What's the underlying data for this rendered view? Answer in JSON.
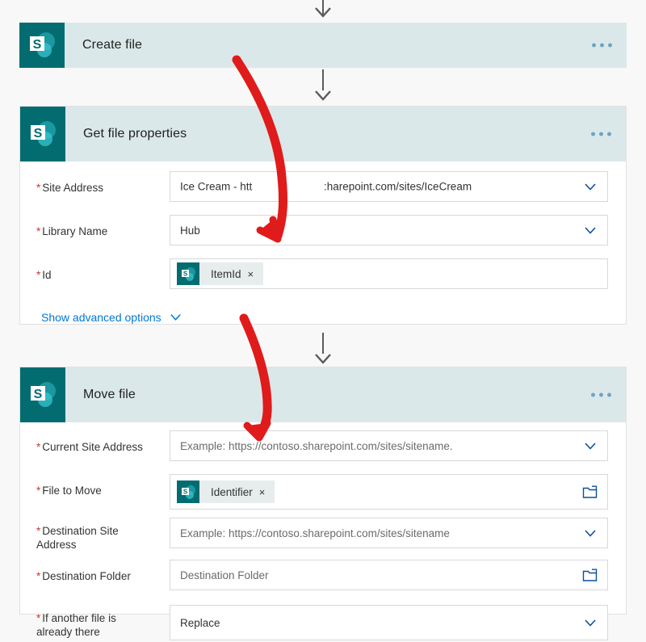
{
  "colors": {
    "sharepoint_teal": "#036C70",
    "card_header_bg": "#DBE8E9",
    "page_bg": "#F8F8F8",
    "annotation_red": "#E01B1B",
    "link_blue": "#0078D4",
    "required_red": "#D13438"
  },
  "cards": [
    {
      "id": "create-file",
      "title": "Create file",
      "icon": "sharepoint-icon",
      "overflow_label": "more-options",
      "fields": []
    },
    {
      "id": "get-file-properties",
      "title": "Get file properties",
      "icon": "sharepoint-icon",
      "overflow_label": "more-options",
      "fields": [
        {
          "label": "Site Address",
          "required": true,
          "type": "dropdown-split",
          "value_left": "Ice Cream - htt",
          "value_right": ":harepoint.com/sites/IceCream"
        },
        {
          "label": "Library Name",
          "required": true,
          "type": "dropdown",
          "value": "Hub"
        },
        {
          "label": "Id",
          "required": true,
          "type": "token",
          "token_label": "ItemId",
          "token_remove": "×",
          "token_icon": "sharepoint-icon"
        }
      ],
      "advanced_options_label": "Show advanced options"
    },
    {
      "id": "move-file",
      "title": "Move file",
      "icon": "sharepoint-icon",
      "overflow_label": "more-options",
      "fields": [
        {
          "label": "Current Site Address",
          "required": true,
          "type": "dropdown",
          "placeholder": "Example: https://contoso.sharepoint.com/sites/sitename."
        },
        {
          "label": "File to Move",
          "required": true,
          "type": "token-folder",
          "token_label": "Identifier",
          "token_remove": "×",
          "token_icon": "sharepoint-icon"
        },
        {
          "label": "Destination Site Address",
          "label_line1": "Destination Site",
          "label_line2": "Address",
          "required": true,
          "type": "dropdown",
          "placeholder": "Example: https://contoso.sharepoint.com/sites/sitename"
        },
        {
          "label": "Destination Folder",
          "required": true,
          "type": "folder",
          "placeholder": "Destination Folder"
        },
        {
          "label": "If another file is already there",
          "label_line1": "If another file is",
          "label_line2": "already there",
          "required": true,
          "type": "dropdown",
          "value": "Replace"
        }
      ]
    }
  ],
  "connectors": [
    {
      "name": "arrow-into-create-file"
    },
    {
      "name": "arrow-create-file-to-get-file-properties"
    },
    {
      "name": "arrow-get-file-properties-to-move-file"
    }
  ],
  "annotations": [
    {
      "name": "red-arrow-create-file-to-id-field"
    },
    {
      "name": "red-arrow-get-file-properties-to-current-site-address"
    }
  ]
}
